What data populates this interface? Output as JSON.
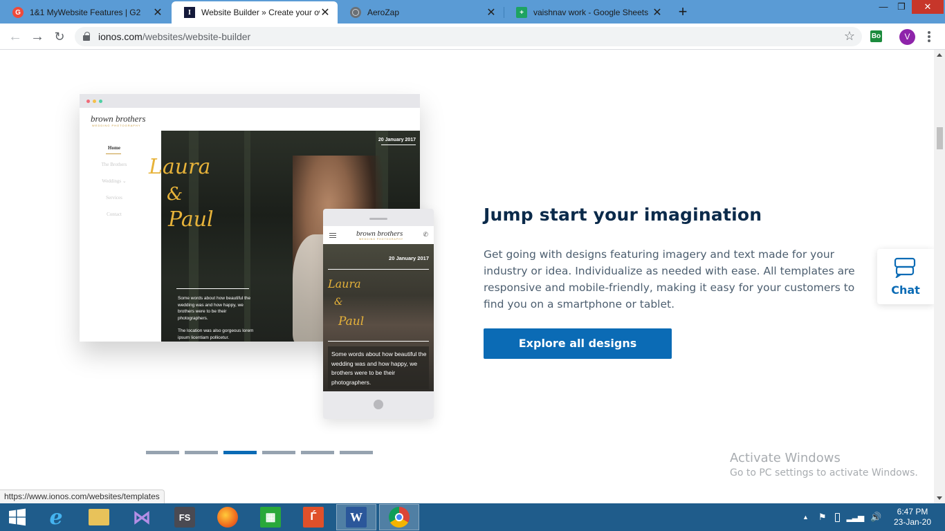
{
  "browser": {
    "tabs": [
      {
        "title": "1&1 MyWebsite Features | G2",
        "icon": "g2-icon",
        "active": false
      },
      {
        "title": "Website Builder » Create your ow",
        "icon": "ionos-icon",
        "active": true
      },
      {
        "title": "AeroZap",
        "icon": "globe-icon",
        "active": false
      },
      {
        "title": "vaishnav work - Google Sheets",
        "icon": "sheets-icon",
        "active": false
      }
    ],
    "url_domain": "ionos.com",
    "url_path": "/websites/website-builder",
    "profile_initial": "V",
    "extension_label": "Bo"
  },
  "mockup": {
    "brand": "brown brothers",
    "brand_sub": "WEDDING PHOTOGRAPHY",
    "nav": [
      "Home",
      "The Brothers",
      "Weddings ⌄",
      "Services",
      "Contact"
    ],
    "date": "20 January 2017",
    "script_1": "Laura",
    "script_2": "&",
    "script_3": "Paul",
    "desk_copy_1": "Some words about how beautiful the wedding was and how happy, we brothers were to be their photographers.",
    "desk_copy_2": "The location was also gorgeous lorem ipsum licentiam pollicetur.",
    "phone_copy": "Some words about how beautiful the wedding was and how happy, we brothers were to be their photographers."
  },
  "content": {
    "headline": "Jump start your imagination",
    "body": "Get going with designs featuring imagery and text made for your industry or idea. Individualize as needed with ease. All templates are responsive and mobile-friendly, making it easy for your customers to find you on a smartphone or tablet.",
    "cta_label": "Explore all designs"
  },
  "chat": {
    "label": "Chat"
  },
  "slider": {
    "count": 6,
    "active_index": 2
  },
  "watermark": {
    "line1": "Activate Windows",
    "line2": "Go to PC settings to activate Windows."
  },
  "status_url": "https://www.ionos.com/websites/templates",
  "taskbar": {
    "time": "6:47 PM",
    "date": "23-Jan-20"
  },
  "colors": {
    "accent": "#0b6bb5",
    "headline": "#0b2a4a",
    "tabstrip": "#5a9bd5",
    "taskbar": "#1f5c8b"
  }
}
